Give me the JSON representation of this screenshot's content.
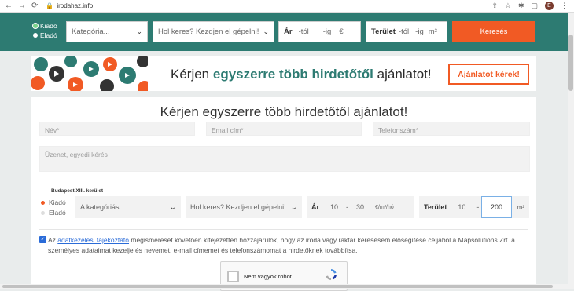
{
  "browser": {
    "url": "irodahaz.info",
    "avatar": "E"
  },
  "topbar": {
    "radios": [
      "Kiadó",
      "Eladó"
    ],
    "category": "Kategória...",
    "search_placeholder": "Hol keres? Kezdjen el gépelni!",
    "price": {
      "label": "Ár",
      "from": "-tól",
      "to": "-ig",
      "unit": "€"
    },
    "area": {
      "label": "Terület",
      "from": "-tól",
      "to": "-ig",
      "unit": "m²"
    },
    "search_button": "Keresés"
  },
  "banner": {
    "text_pre": "Kérjen ",
    "text_strong": "egyszerre több hirdetőtől",
    "text_post": " ajánlatot!",
    "cta": "Ajánlatot kérek!"
  },
  "form": {
    "title": "Kérjen egyszerre több hirdetőtől ajánlatot!",
    "name_placeholder": "Név*",
    "email_placeholder": "Email cím*",
    "phone_placeholder": "Telefonszám*",
    "message_placeholder": "Üzenet, egyedi kérés",
    "location_label": "Budapest XIII. kerület",
    "radios": [
      "Kiadó",
      "Eladó"
    ],
    "category": "A kategóriás",
    "search_placeholder": "Hol keres? Kezdjen el gépelni!",
    "price": {
      "label": "Ár",
      "from": "10",
      "to": "30",
      "unit": "€/m²/hó"
    },
    "area": {
      "label": "Terület",
      "from": "10",
      "to": "200",
      "unit": "m²"
    },
    "consent_pre": "Az ",
    "consent_link": "adatkezelési tájékoztató",
    "consent_post": " megismerését követően kifejezetten hozzájárulok, hogy az iroda vagy raktár keresésem elősegítése céljából a Mapsolutions Zrt. a személyes adataimat kezelje és nevemet, e-mail címemet és telefonszámomat a hirdetőknek továbbítsa.",
    "captcha": "Nem vagyok robot"
  },
  "colors": {
    "accent": "#f15a24",
    "brand": "#2d7b72",
    "link": "#2a6bd8"
  }
}
